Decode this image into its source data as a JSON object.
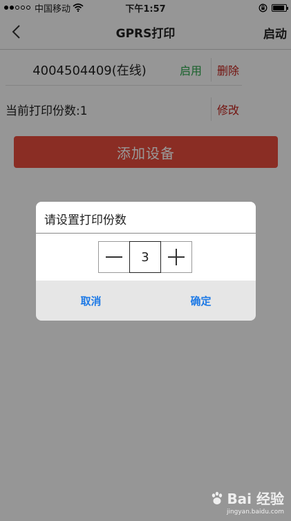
{
  "status_bar": {
    "carrier": "中国移动",
    "time": "下午1:57",
    "signal_filled": 2,
    "battery_level": 0.9
  },
  "nav": {
    "title": "GPRS打印",
    "action": "启动"
  },
  "device": {
    "name": "4004504409(在线)",
    "enable_label": "启用",
    "delete_label": "删除"
  },
  "copies_row": {
    "label": "当前打印份数:1",
    "modify_label": "修改"
  },
  "add_device_label": "添加设备",
  "dialog": {
    "title": "请设置打印份数",
    "value": "3",
    "cancel_label": "取消",
    "confirm_label": "确定"
  },
  "watermark": {
    "brand": "Bai 经验",
    "url": "jingyan.baidu.com"
  },
  "colors": {
    "enable": "#2aa44a",
    "delete": "#c0201a",
    "add_button": "#e74c3c",
    "dialog_button": "#1e7ae6"
  }
}
